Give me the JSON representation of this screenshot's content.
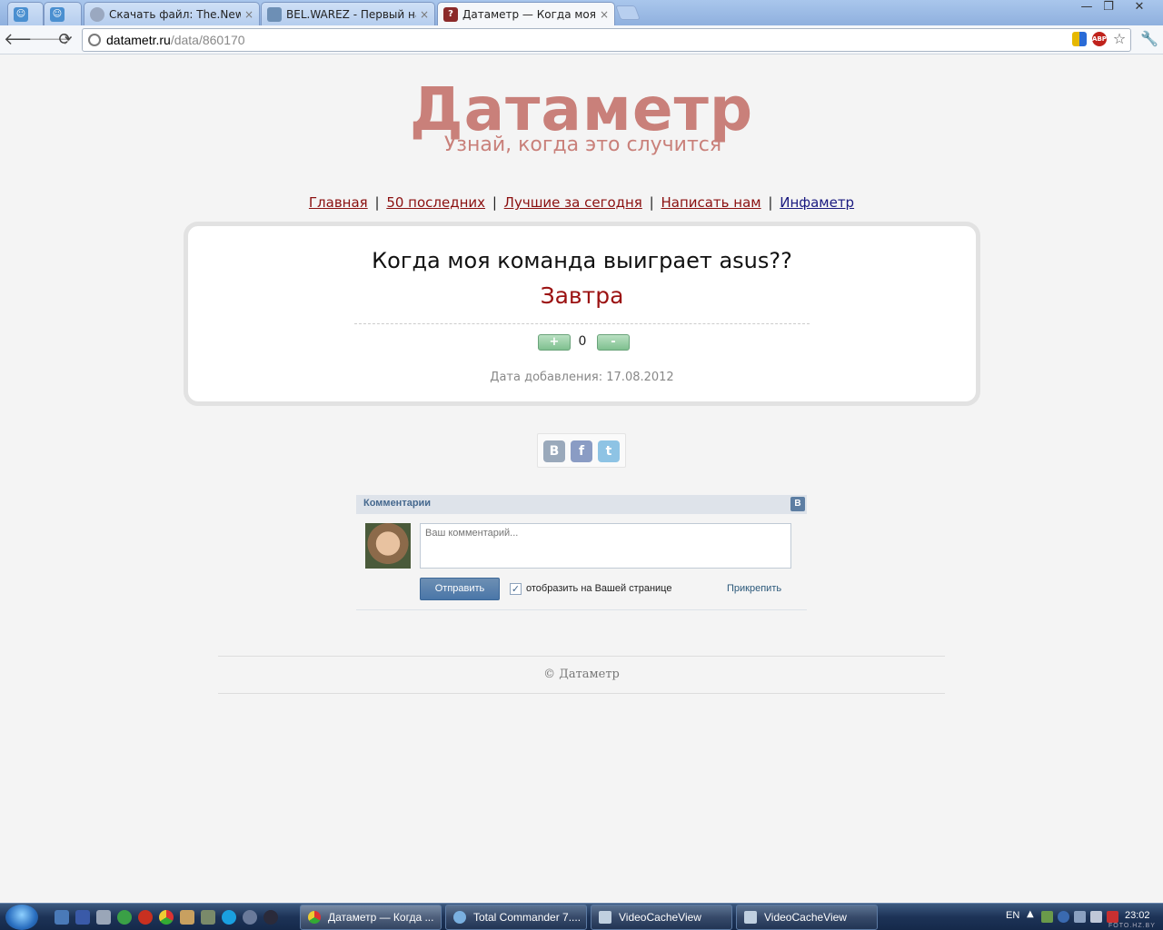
{
  "browser": {
    "tabs": [
      {
        "label": "",
        "active": false
      },
      {
        "label": "",
        "active": false
      },
      {
        "label": "Скачать файл: The.Newsro",
        "active": false
      },
      {
        "label": "BEL.WAREZ - Первый наст",
        "active": false
      },
      {
        "label": "Датаметр — Когда моя ко",
        "active": true
      }
    ],
    "url_host": "datametr.ru",
    "url_path": "/data/860170",
    "close_glyph": "×",
    "window_controls": {
      "minimize": "—",
      "restore": "❐",
      "close": "✕"
    },
    "extensions": {
      "abp": "ABP"
    }
  },
  "site": {
    "logo_title": "Датаметр",
    "logo_subtitle": "Узнай, когда это случится",
    "nav": {
      "home": "Главная",
      "latest": "50 последних",
      "best_today": "Лучшие за сегодня",
      "contact": "Написать нам",
      "infametr": "Инфаметр",
      "separator": "|"
    }
  },
  "card": {
    "question": "Когда моя команда выиграет asus??",
    "answer": "Завтра",
    "vote_plus": "+",
    "vote_minus": "-",
    "score": "0",
    "date_added": "Дата добавления: 17.08.2012"
  },
  "share": {
    "vk": "B",
    "facebook": "f",
    "twitter": "t"
  },
  "comments": {
    "title": "Комментарии",
    "vk_badge": "B",
    "placeholder": "Ваш комментарий...",
    "send_label": "Отправить",
    "checkbox_checked": true,
    "checkbox_mark": "✓",
    "checkbox_label": "отобразить на Вашей странице",
    "attach_label": "Прикрепить"
  },
  "footer": {
    "copyright": "© Датаметр"
  },
  "taskbar": {
    "tasks": [
      {
        "label": "Датаметр — Когда ...",
        "active": true
      },
      {
        "label": "Total Commander 7....",
        "active": false
      },
      {
        "label": "VideoCacheView",
        "active": false
      },
      {
        "label": "VideoCacheView",
        "active": false
      }
    ],
    "language": "EN",
    "clock": "23:02",
    "watermark": "FOTO.HZ.BY"
  },
  "colors": {
    "logo": "#c9807a",
    "link": "#8b1010",
    "answer": "#9b1212",
    "vk_blue": "#4a76a8",
    "vote_green": "#7fc08f"
  }
}
